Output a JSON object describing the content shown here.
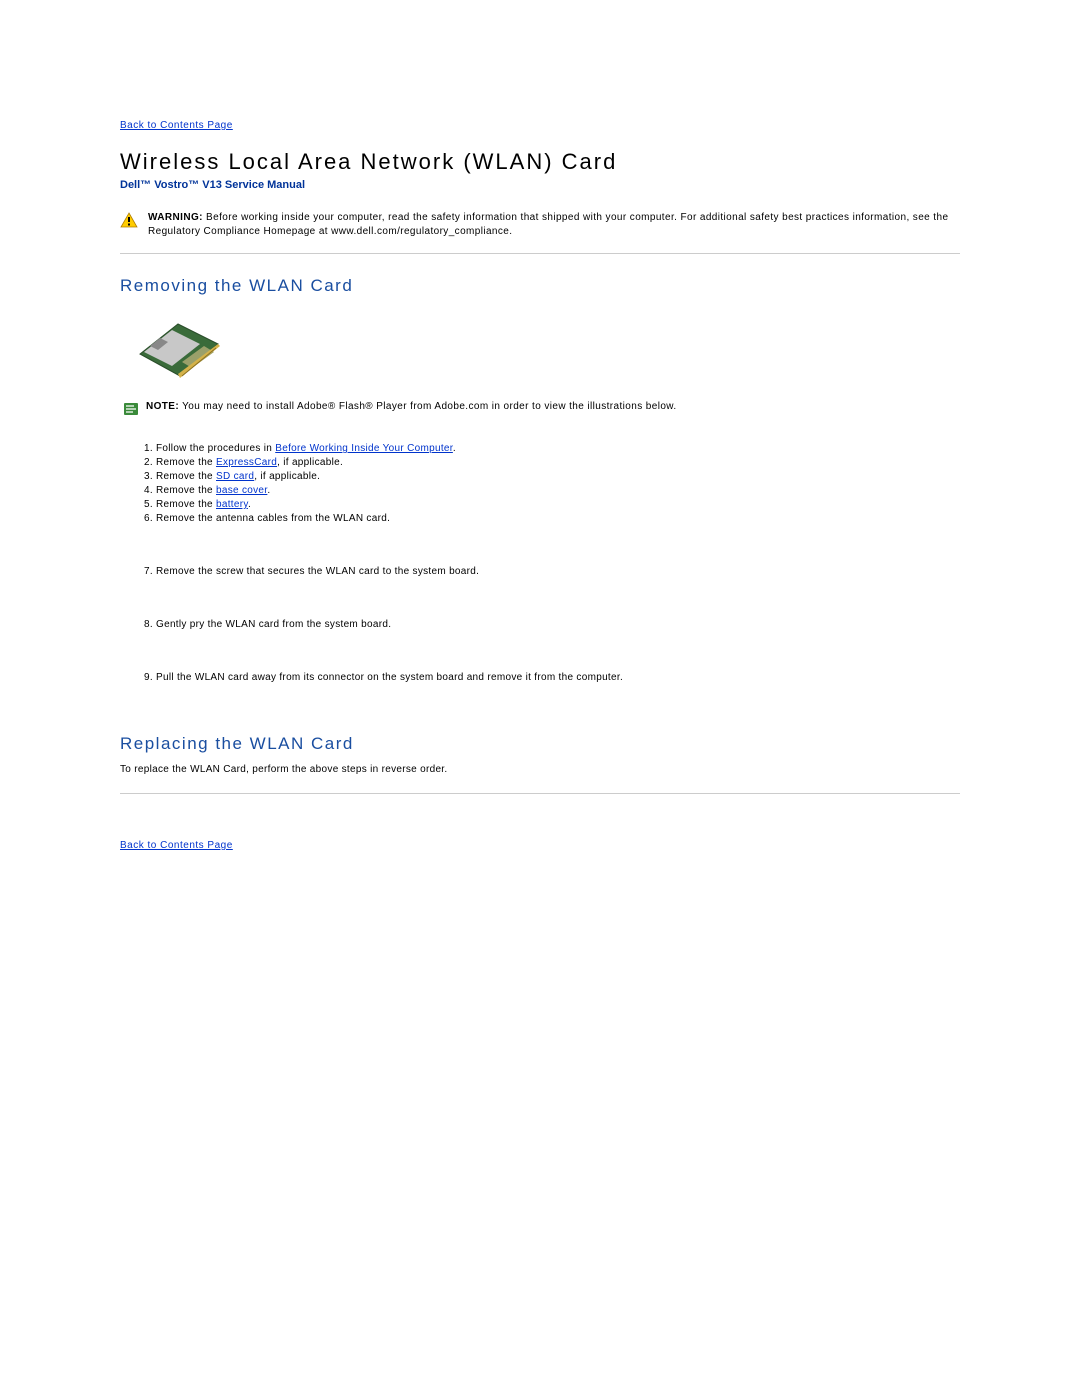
{
  "nav": {
    "back_top": "Back to Contents Page",
    "back_bottom": "Back to Contents Page"
  },
  "header": {
    "title": "Wireless Local Area Network (WLAN) Card",
    "subtitle": "Dell™ Vostro™ V13 Service Manual"
  },
  "warning": {
    "label": "WARNING:",
    "text": " Before working inside your computer, read the safety information that shipped with your computer. For additional safety best practices information, see the Regulatory Compliance Homepage at www.dell.com/regulatory_compliance."
  },
  "sections": {
    "removing_title": "Removing the WLAN Card",
    "replacing_title": "Replacing the WLAN Card",
    "replace_text": "To replace the WLAN Card, perform the above steps in reverse order."
  },
  "note": {
    "label": "NOTE:",
    "text": " You may need to install Adobe® Flash® Player from Adobe.com in order to view the illustrations below."
  },
  "steps": {
    "1": {
      "pre": "Follow the procedures in ",
      "link": "Before Working Inside Your Computer",
      "post": "."
    },
    "2": {
      "pre": "Remove the ",
      "link": "ExpressCard",
      "post": ", if applicable."
    },
    "3": {
      "pre": "Remove the ",
      "link": "SD card",
      "post": ", if applicable."
    },
    "4": {
      "pre": "Remove the ",
      "link": "base cover",
      "post": "."
    },
    "5": {
      "pre": "Remove the ",
      "link": "battery",
      "post": "."
    },
    "6": {
      "text": "Remove the antenna cables from the WLAN card."
    },
    "7": {
      "text": "Remove the screw that secures the WLAN card to the system board."
    },
    "8": {
      "text": "Gently pry the WLAN card from the system board."
    },
    "9": {
      "text": "Pull the WLAN card away from its connector on the system board and remove it from the computer."
    }
  }
}
